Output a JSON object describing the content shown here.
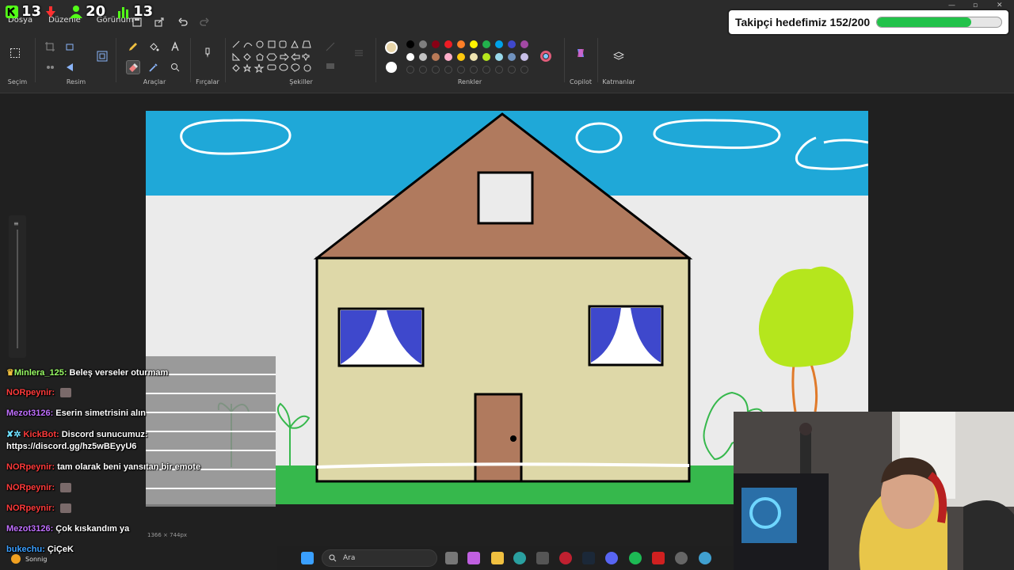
{
  "app": {
    "menus": [
      "Dosya",
      "Düzenle",
      "Görünüm"
    ]
  },
  "ribbon": {
    "groups": {
      "selection": "Seçim",
      "image": "Resim",
      "tools": "Araçlar",
      "brushes": "Fırçalar",
      "shapes": "Şekiller",
      "colors": "Renkler",
      "copilot": "Copilot",
      "layers": "Katmanlar"
    },
    "palette_row1": [
      "#000000",
      "#7f7f7f",
      "#880015",
      "#ed1c24",
      "#ff7f27",
      "#fff200",
      "#22b14c",
      "#00a2e8",
      "#3f48cc",
      "#a349a4"
    ],
    "palette_row2": [
      "#ffffff",
      "#c3c3c3",
      "#b97a57",
      "#ffaec9",
      "#ffc90e",
      "#efe4b0",
      "#b5e61d",
      "#99d9ea",
      "#7092be",
      "#c8bfe7"
    ],
    "primary_color": "#e8d5a9",
    "secondary_color": "#ffffff"
  },
  "stream": {
    "stats": [
      {
        "icon": "kick-icon",
        "value": "13",
        "color": "#53fc18"
      },
      {
        "icon": "user-icon",
        "value": "20",
        "color": "#53fc18"
      },
      {
        "icon": "bar-chart-icon",
        "value": "13",
        "color": "#53fc18"
      }
    ],
    "goal": {
      "text": "Takipçi hedefimiz 152/200",
      "progress": 0.76
    }
  },
  "chat": {
    "messages": [
      {
        "user": "Minlera_125:",
        "text": "Beleş verseler oturmam",
        "color": "#9bff66",
        "badge": true
      },
      {
        "user": "NORpeynir:",
        "text": "",
        "color": "#ff3b3b",
        "emote": true
      },
      {
        "user": "Mezot3126:",
        "text": "Eserin simetrisini alın",
        "color": "#c070ff"
      },
      {
        "user": "KickBot:",
        "text": "Discord sunucumuz:",
        "color": "#ff3b3b",
        "bot": true
      },
      {
        "user": "",
        "text": "https://discord.gg/hz5wBEyyU6",
        "color": "#ffffff"
      },
      {
        "user": "NORpeynir:",
        "text": "tam olarak beni yansıtan bir emote",
        "color": "#ff3b3b"
      },
      {
        "user": "NORpeynir:",
        "text": "",
        "color": "#ff3b3b",
        "emote": true
      },
      {
        "user": "NORpeynir:",
        "text": "",
        "color": "#ff3b3b",
        "emote": true
      },
      {
        "user": "Mezot3126:",
        "text": "Çok kıskandım ya",
        "color": "#c070ff"
      },
      {
        "user": "bukechu:",
        "text": "ÇiÇeK",
        "color": "#3a9fff"
      }
    ]
  },
  "status": {
    "canvas_size": "1366 × 744px",
    "weather": "Sonnig"
  },
  "taskbar": {
    "search_placeholder": "Ara"
  }
}
